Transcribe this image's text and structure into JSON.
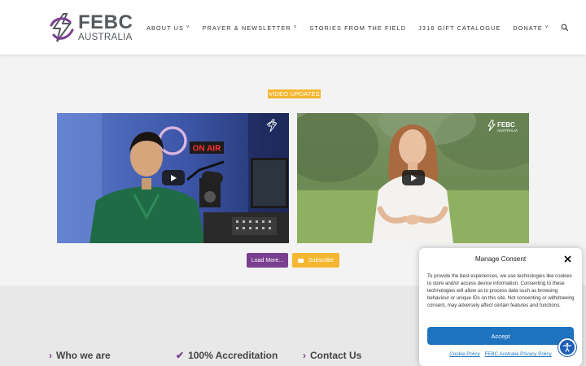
{
  "logo": {
    "title": "FEBC",
    "subtitle": "AUSTRALIA",
    "brand_purple": "#7a3f8f",
    "brand_gray": "#555a5f"
  },
  "nav": {
    "items": [
      {
        "label": "ABOUT US",
        "dropdown": true
      },
      {
        "label": "PRAYER & NEWSLETTER",
        "dropdown": true
      },
      {
        "label": "STORIES FROM THE FIELD",
        "dropdown": false
      },
      {
        "label": "J316 GIFT CATALOGUE",
        "dropdown": false
      },
      {
        "label": "DONATE",
        "dropdown": true
      }
    ],
    "search_icon": "search-icon"
  },
  "section": {
    "label": "VIDEO UPDATES",
    "label_color": "#f5b731"
  },
  "videos": [
    {
      "name": "video-on-air-studio",
      "watermark": ""
    },
    {
      "name": "video-woman-outdoors",
      "watermark": "FEBC AUSTRALIA"
    }
  ],
  "buttons": {
    "load_more": "Load More...",
    "subscribe": "Subscribe"
  },
  "footer": {
    "cols": [
      {
        "label": "Who we are",
        "icon": "chevron-right-icon"
      },
      {
        "label": "100% Accreditation",
        "icon": "check-icon"
      },
      {
        "label": "Contact Us",
        "icon": "chevron-right-icon"
      }
    ]
  },
  "consent": {
    "title": "Manage Consent",
    "body": "To provide the best experiences, we use technologies like cookies to store and/or access device information. Consenting to these technologies will allow us to process data such as browsing behaviour or unique IDs on this site. Not consenting or withdrawing consent, may adversely affect certain features and functions.",
    "accept": "Accept",
    "links": [
      "Cookie Policy",
      "FEBC Australia Privacy Policy"
    ],
    "accent": "#1e73be"
  }
}
